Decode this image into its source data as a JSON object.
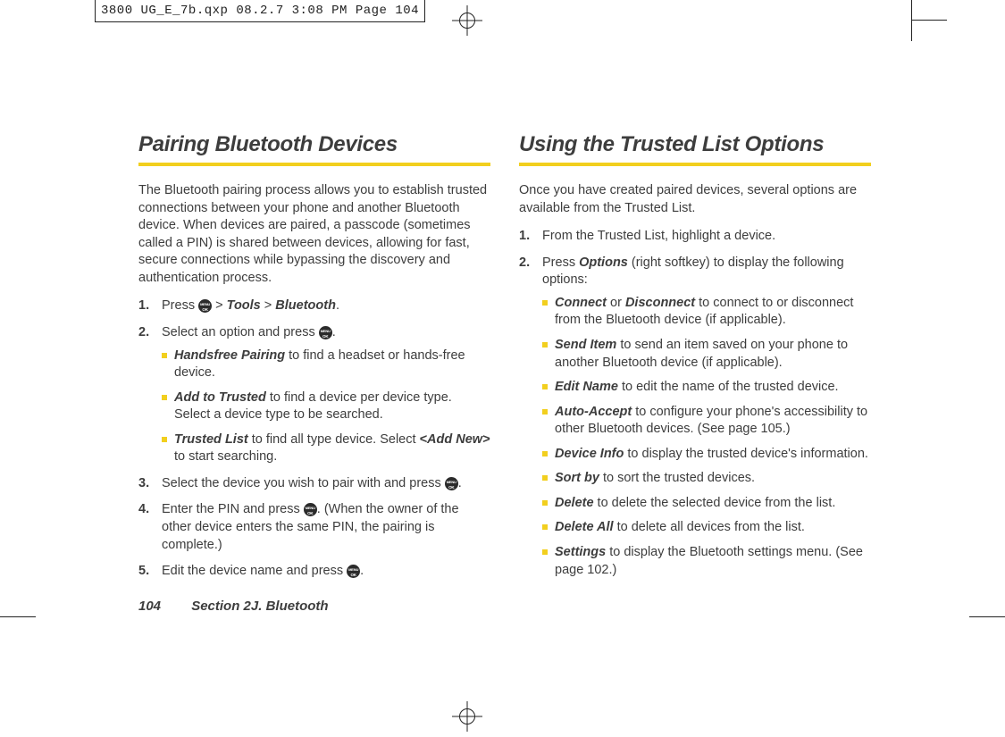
{
  "crop_header": "3800 UG_E_7b.qxp  08.2.7  3:08 PM  Page 104",
  "footer": {
    "page_number": "104",
    "section": "Section 2J. Bluetooth"
  },
  "left": {
    "title": "Pairing Bluetooth Devices",
    "intro": "The Bluetooth pairing process allows you to establish trusted connections between your phone and another Bluetooth device. When devices are paired, a passcode (sometimes called a PIN) is shared between devices, allowing for fast, secure connections while bypassing the discovery and authentication process.",
    "step1": {
      "pre": "Press ",
      "tools": "Tools",
      "bluetooth": "Bluetooth"
    },
    "step2": {
      "pre": "Select an option and press "
    },
    "sub": {
      "hf": {
        "bold": "Handsfree Pairing",
        "rest": " to find a headset or hands-free device."
      },
      "att": {
        "bold": "Add to Trusted",
        "rest": " to find a device per device type. Select a device type to be searched."
      },
      "tl": {
        "bold": "Trusted List",
        "rest_a": " to find all type device. Select ",
        "addnew": "<Add New>",
        "rest_b": " to start searching."
      }
    },
    "step3": {
      "pre": "Select the device you wish to pair with and press "
    },
    "step4": {
      "pre": "Enter the PIN and press ",
      "post": ". (When the owner of the other device enters the same PIN, the pairing is complete.)"
    },
    "step5": {
      "pre": "Edit the device name and press "
    }
  },
  "right": {
    "title": "Using the Trusted List Options",
    "intro": "Once you have created paired devices, several options are available from the Trusted List.",
    "step1": "From the Trusted List, highlight a device.",
    "step2": {
      "pre": "Press ",
      "options": "Options",
      "post": " (right softkey) to display the following options:"
    },
    "sub": {
      "connect": {
        "b1": "Connect",
        "or": " or ",
        "b2": "Disconnect",
        "rest": " to connect to or disconnect from the Bluetooth device (if applicable)."
      },
      "senditem": {
        "bold": "Send Item",
        "rest": " to send an item saved on your phone to another Bluetooth device (if applicable)."
      },
      "editname": {
        "bold": "Edit Name",
        "rest": " to edit the name of the trusted device."
      },
      "autoaccept": {
        "bold": "Auto-Accept",
        "rest": " to configure your phone's accessibility to other Bluetooth devices. (See page 105.)"
      },
      "deviceinfo": {
        "bold": "Device Info",
        "rest": " to display the trusted device's information."
      },
      "sortby": {
        "bold": "Sort by",
        "rest": " to sort the trusted devices."
      },
      "delete": {
        "bold": "Delete",
        "rest": " to delete the selected device from the list."
      },
      "deleteall": {
        "bold": "Delete All",
        "rest": " to delete all devices from the list."
      },
      "settings": {
        "bold": "Settings",
        "rest": " to display the Bluetooth settings menu. (See page 102.)"
      }
    }
  }
}
